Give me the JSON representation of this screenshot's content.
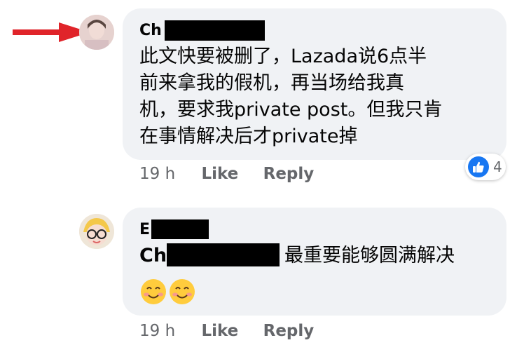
{
  "comments": [
    {
      "author_visible": "Ch",
      "text_lines": [
        "此文快要被删了，Lazada说6点半",
        "前来拿我的假机，再当场给我真",
        "机，要求我private post。但我只肯",
        "在事情解决后才private掉"
      ],
      "time": "19 h",
      "like_label": "Like",
      "reply_label": "Reply",
      "reaction_count": "4"
    },
    {
      "author_visible": "E",
      "mention_visible": "Ch",
      "text": "最重要能够圆满解决",
      "time": "19 h",
      "like_label": "Like",
      "reply_label": "Reply"
    }
  ],
  "colors": {
    "bubble": "#f0f2f5",
    "meta_text": "#65676b",
    "arrow": "#e0242a",
    "like_blue": "#1877f2"
  },
  "icons": [
    "arrow-annotation",
    "like-thumb-icon",
    "smile-emoji-icon"
  ]
}
